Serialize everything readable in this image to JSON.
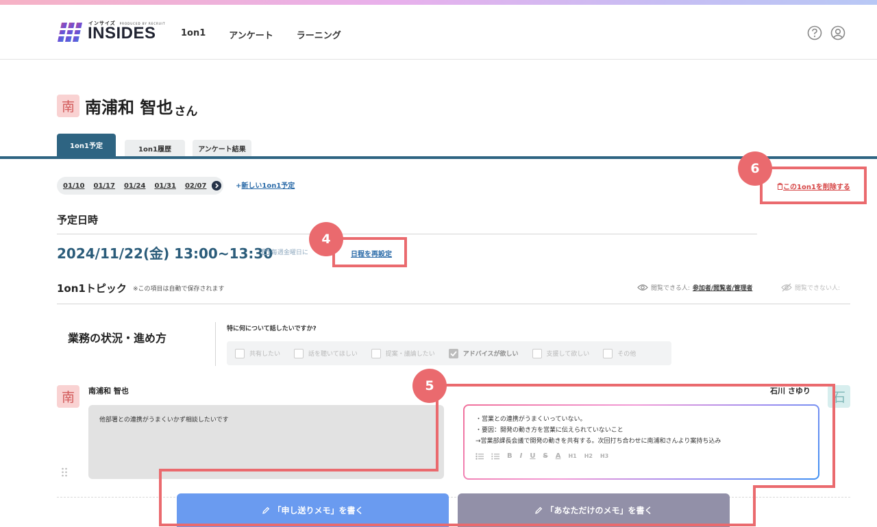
{
  "header": {
    "logo_small": "インサイズ",
    "logo_by": "PRODUCED BY RECRUIT",
    "logo_text": "INSIDES",
    "nav": [
      "1on1",
      "アンケート",
      "ラーニング"
    ]
  },
  "person": {
    "avatar": "南",
    "name": "南浦和 智也",
    "suffix": "さん"
  },
  "tabs": [
    "1on1予定",
    "1on1履歴",
    "アンケート結果"
  ],
  "dates": [
    "01/10",
    "01/17",
    "01/24",
    "01/31",
    "02/07"
  ],
  "new_link": "新しい1on1予定",
  "delete_link": "この1on1を削除する",
  "schedule": {
    "label": "予定日時",
    "datetime": "2024/11/22(金) 13:00~13:30",
    "repeat": "毎週金曜日に",
    "reschedule": "日程を再設定"
  },
  "topic": {
    "title": "1on1トピック",
    "note": "※この項目は自動で保存されます",
    "viewers_label": "閲覧できる人:",
    "viewers_link": "参加者/閲覧者/管理者",
    "noviewers_label": "閲覧できない人:",
    "name": "業務の状況・進め方",
    "question": "特に何について話したいですか?",
    "options": [
      {
        "label": "共有したい",
        "checked": false
      },
      {
        "label": "話を聴いてほしい",
        "checked": false
      },
      {
        "label": "提案・議論したい",
        "checked": false
      },
      {
        "label": "アドバイスが欲しい",
        "checked": true
      },
      {
        "label": "支援して欲しい",
        "checked": false
      },
      {
        "label": "その他",
        "checked": false
      }
    ]
  },
  "memo": {
    "left_avatar": "南",
    "left_name": "南浦和 智也",
    "left_text": "他部署との連携がうまくいかず相談したいです",
    "right_name": "石川 さゆり",
    "right_avatar": "石",
    "right_lines": [
      "・営業との連携がうまくいっていない。",
      "・要因：開発の動き方を営業に伝えられていないこと",
      "→営業部課長会議で開発の動きを共有する。次回打ち合わせに南浦和さんより案持ち込み"
    ],
    "toolbar": [
      "B",
      "I",
      "U",
      "S",
      "A",
      "H1",
      "H2",
      "H3"
    ]
  },
  "buttons": {
    "send_memo": "「申し送りメモ」を書く",
    "private_memo": "「あなただけのメモ」を書く"
  },
  "annotations": {
    "badge4": "4",
    "badge5": "5",
    "badge6": "6",
    "color": "#ea6a6e"
  }
}
